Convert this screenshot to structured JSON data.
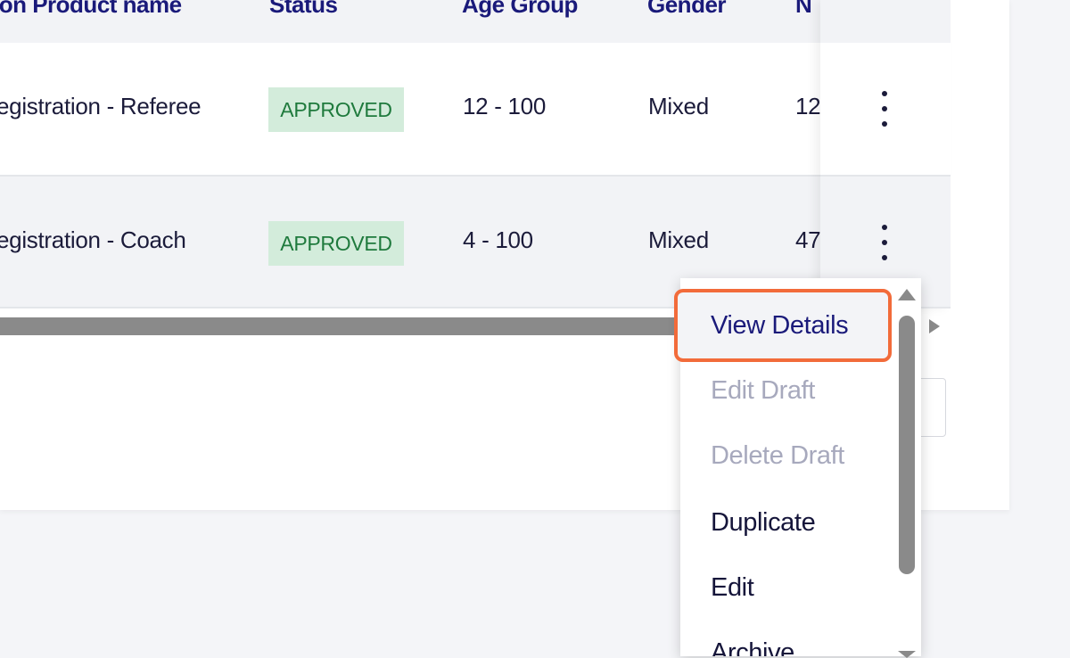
{
  "table": {
    "columns": [
      "ion Product name",
      "Status",
      "Age Group",
      "Gender",
      "N"
    ],
    "rows": [
      {
        "product": "egistration - Referee",
        "status": "APPROVED",
        "age_group": "12 - 100",
        "gender": "Mixed",
        "num": "12"
      },
      {
        "product": "egistration - Coach",
        "status": "APPROVED",
        "age_group": "4 - 100",
        "gender": "Mixed",
        "num": "47"
      }
    ]
  },
  "menu": {
    "items": [
      {
        "label": "View Details",
        "state": "highlighted"
      },
      {
        "label": "Edit Draft",
        "state": "disabled"
      },
      {
        "label": "Delete Draft",
        "state": "disabled"
      },
      {
        "label": "Duplicate",
        "state": "enabled"
      },
      {
        "label": "Edit",
        "state": "enabled"
      },
      {
        "label": "Archive",
        "state": "enabled"
      }
    ]
  },
  "colors": {
    "header_text": "#1a1a7a",
    "badge_bg": "#d3ecdb",
    "badge_text": "#1f7a3d",
    "highlight_border": "#f26b3a",
    "disabled_text": "#a7a9bd"
  },
  "icons": {
    "row_actions": "kebab-vertical-icon",
    "scroll_right": "arrow-right-icon",
    "scroll_up": "arrow-up-icon",
    "scroll_down": "arrow-down-icon"
  }
}
